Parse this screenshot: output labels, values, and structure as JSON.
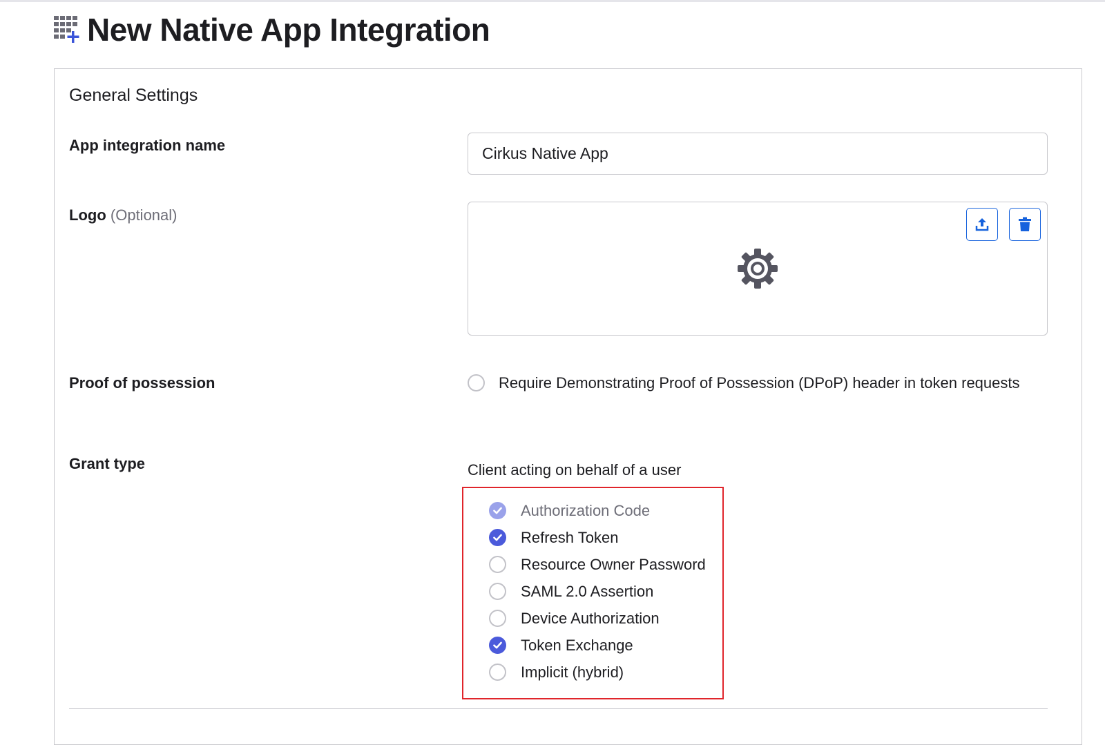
{
  "page": {
    "title": "New Native App Integration",
    "icon": "app-grid-add-icon"
  },
  "general_settings": {
    "section_title": "General Settings",
    "app_name": {
      "label": "App integration name",
      "value": "Cirkus Native App"
    },
    "logo": {
      "label": "Logo",
      "optional": "(Optional)",
      "placeholder_icon": "gear-icon",
      "upload_icon": "upload-icon",
      "delete_icon": "trash-icon"
    },
    "proof_of_possession": {
      "label": "Proof of possession",
      "option_text": "Require Demonstrating Proof of Possession (DPoP) header in token requests",
      "checked": false
    },
    "grant_type": {
      "label": "Grant type",
      "subheading": "Client acting on behalf of a user",
      "options": [
        {
          "label": "Authorization Code",
          "checked": true,
          "disabled": true
        },
        {
          "label": "Refresh Token",
          "checked": true,
          "disabled": false
        },
        {
          "label": "Resource Owner Password",
          "checked": false,
          "disabled": false
        },
        {
          "label": "SAML 2.0 Assertion",
          "checked": false,
          "disabled": false
        },
        {
          "label": "Device Authorization",
          "checked": false,
          "disabled": false
        },
        {
          "label": "Token Exchange",
          "checked": true,
          "disabled": false
        },
        {
          "label": "Implicit (hybrid)",
          "checked": false,
          "disabled": false
        }
      ]
    }
  },
  "colors": {
    "accent": "#4b5adb",
    "button_border": "#1662dd",
    "highlight": "#e0252b"
  }
}
